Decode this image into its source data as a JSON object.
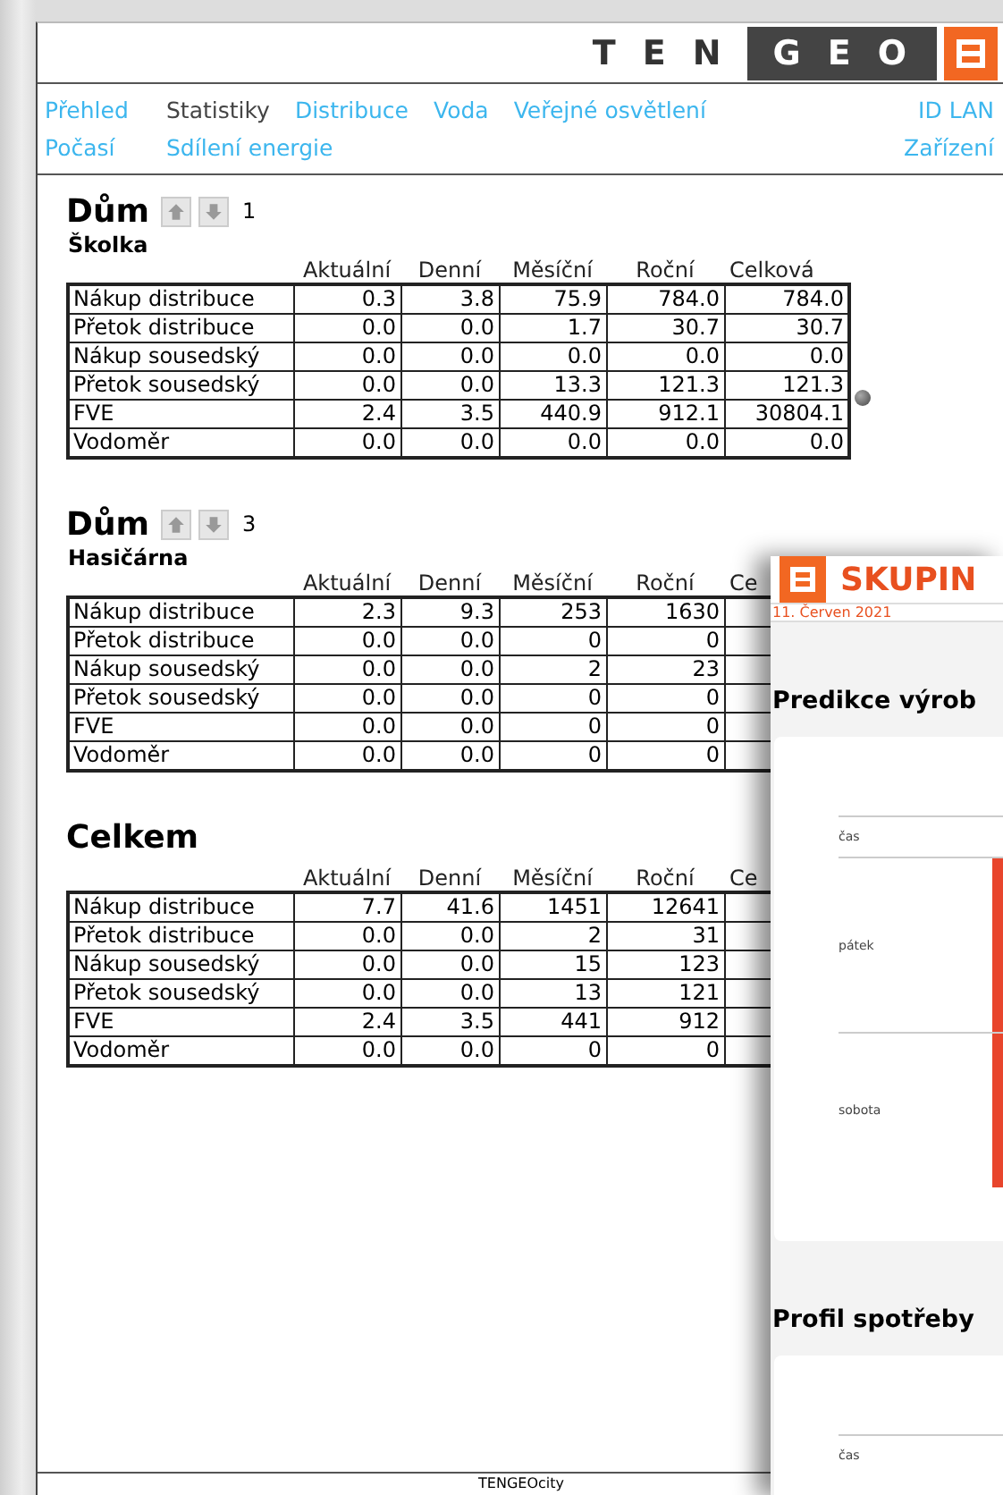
{
  "logo": {
    "light": "TEN",
    "dark": "GEO"
  },
  "nav": {
    "rows": [
      [
        {
          "label": "Přehled",
          "selected": false
        },
        {
          "label": "Statistiky",
          "selected": true
        },
        {
          "label": "Distribuce",
          "selected": false
        },
        {
          "label": "Voda",
          "selected": false
        },
        {
          "label": "Veřejné osvětlení",
          "selected": false
        }
      ],
      [
        {
          "label": "Počasí",
          "selected": false
        },
        {
          "label": "Sdílení energie",
          "selected": false
        }
      ]
    ],
    "right": [
      {
        "label": "ID LAN",
        "selected": false
      },
      {
        "label": "Zařízení",
        "selected": false
      }
    ]
  },
  "sections": [
    {
      "title": "Dům",
      "arrows": true,
      "number": "1",
      "subtitle": "Školka",
      "dot": true,
      "columns": [
        "Aktuální",
        "Denní",
        "Měsíční",
        "Roční",
        "Celková"
      ],
      "rows": [
        {
          "label": "Nákup distribuce",
          "values": [
            "0.3",
            "3.8",
            "75.9",
            "784.0",
            "784.0"
          ]
        },
        {
          "label": "Přetok distribuce",
          "values": [
            "0.0",
            "0.0",
            "1.7",
            "30.7",
            "30.7"
          ]
        },
        {
          "label": "Nákup sousedský",
          "values": [
            "0.0",
            "0.0",
            "0.0",
            "0.0",
            "0.0"
          ]
        },
        {
          "label": "Přetok sousedský",
          "values": [
            "0.0",
            "0.0",
            "13.3",
            "121.3",
            "121.3"
          ]
        },
        {
          "label": "FVE",
          "values": [
            "2.4",
            "3.5",
            "440.9",
            "912.1",
            "30804.1"
          ]
        },
        {
          "label": "Vodoměr",
          "values": [
            "0.0",
            "0.0",
            "0.0",
            "0.0",
            "0.0"
          ]
        }
      ]
    },
    {
      "title": "Dům",
      "arrows": true,
      "number": "3",
      "subtitle": "Hasičárna",
      "dot": false,
      "columns": [
        "Aktuální",
        "Denní",
        "Měsíční",
        "Roční",
        "Ce"
      ],
      "rows": [
        {
          "label": "Nákup distribuce",
          "values": [
            "2.3",
            "9.3",
            "253",
            "1630"
          ]
        },
        {
          "label": "Přetok distribuce",
          "values": [
            "0.0",
            "0.0",
            "0",
            "0"
          ]
        },
        {
          "label": "Nákup sousedský",
          "values": [
            "0.0",
            "0.0",
            "2",
            "23"
          ]
        },
        {
          "label": "Přetok sousedský",
          "values": [
            "0.0",
            "0.0",
            "0",
            "0"
          ]
        },
        {
          "label": "FVE",
          "values": [
            "0.0",
            "0.0",
            "0",
            "0"
          ]
        },
        {
          "label": "Vodoměr",
          "values": [
            "0.0",
            "0.0",
            "0",
            "0"
          ]
        }
      ]
    },
    {
      "title": "Celkem",
      "arrows": false,
      "dot": false,
      "columns": [
        "Aktuální",
        "Denní",
        "Měsíční",
        "Roční",
        "Ce"
      ],
      "rows": [
        {
          "label": "Nákup distribuce",
          "values": [
            "7.7",
            "41.6",
            "1451",
            "12641"
          ]
        },
        {
          "label": "Přetok distribuce",
          "values": [
            "0.0",
            "0.0",
            "2",
            "31"
          ]
        },
        {
          "label": "Nákup sousedský",
          "values": [
            "0.0",
            "0.0",
            "15",
            "123"
          ]
        },
        {
          "label": "Přetok sousedský",
          "values": [
            "0.0",
            "0.0",
            "13",
            "121"
          ]
        },
        {
          "label": "FVE",
          "values": [
            "2.4",
            "3.5",
            "441",
            "912"
          ]
        },
        {
          "label": "Vodoměr",
          "values": [
            "0.0",
            "0.0",
            "0",
            "0"
          ]
        }
      ]
    }
  ],
  "footer": "TENGEOcity",
  "overlay": {
    "brand": "SKUPIN",
    "date": "11. Červen 2021",
    "panels": [
      {
        "title": "Predikce výrob",
        "column": "čas",
        "rows": [
          "pátek",
          "sobota"
        ]
      },
      {
        "title": "Profil spotřeby",
        "column": "čas"
      }
    ]
  }
}
